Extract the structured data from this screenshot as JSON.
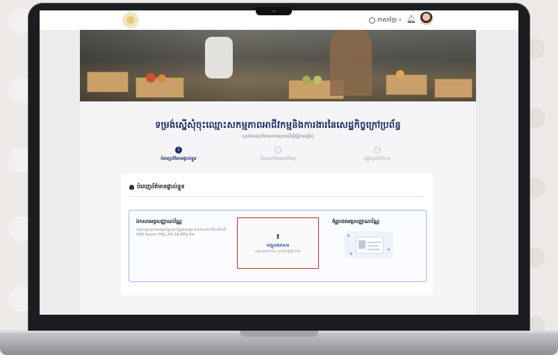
{
  "header": {
    "language_label": "ភាសាខ្មែរ",
    "language_icon": "globe-icon",
    "notification_icon": "bell-icon"
  },
  "page": {
    "title": "ទម្រង់ស្នើសុំចុះឈ្មោះសកម្មភាពអាជីវកម្មនិងការងារនៃសេដ្ឋកិច្ចក្រៅប្រព័ន្ធ",
    "subtitle": "សូមបំពេញព័ត៌មានខាងក្រោមដើម្បីធ្វើការស្នើសុំ"
  },
  "steps": [
    {
      "number": "1",
      "label": "បំពេញព័ត៌មានផ្ទាល់ខ្លួន",
      "state": "active"
    },
    {
      "number": "2",
      "label": "បំពេញព័ត៌មានអាជីវកម្ម",
      "state": "idle"
    },
    {
      "number": "3",
      "label": "ផ្ទៀងផ្ទាត់ព័ត៌មាន",
      "state": "idle"
    }
  ],
  "card": {
    "title": "បំពេញព័ត៌មានផ្ទាល់ខ្លួន",
    "doc_title": "ឯកសារអត្តសញ្ញាណប័ណ្ណ",
    "doc_desc": "សូមបញ្ចូលរូបភាពអត្តសញ្ញាណប័ណ្ណរបស់អ្នក ដែលមានទំហំមិនលើសពី 5MB ជាប្រភេទ PNG, JPG និង JPEG file",
    "upload_label": "បញ្ចូលឯកសារ",
    "upload_hint": "ទាញទម្លាក់ឯកសារ ឬចុចដើម្បីជ្រើសរើស",
    "sample_title": "គំរូរូបថតអត្តសញ្ញាណប័ណ្ណ"
  }
}
